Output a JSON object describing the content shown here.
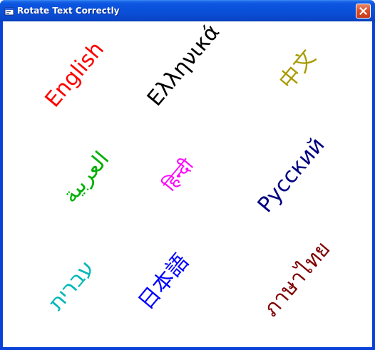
{
  "window": {
    "title": "Rotate Text Correctly"
  },
  "labels": [
    {
      "id": "english",
      "text": "English",
      "color": "#ff0000"
    },
    {
      "id": "greek",
      "text": "Ελληνικά",
      "color": "#000000"
    },
    {
      "id": "chinese",
      "text": "中文",
      "color": "#a89a00"
    },
    {
      "id": "arabic",
      "text": "العربية",
      "color": "#00b000"
    },
    {
      "id": "hindi",
      "text": "हिन्दी",
      "color": "#ff00ff"
    },
    {
      "id": "russian",
      "text": "Русский",
      "color": "#000080"
    },
    {
      "id": "hebrew",
      "text": "עברית",
      "color": "#00b8b8"
    },
    {
      "id": "japanese",
      "text": "日本語",
      "color": "#0000ff"
    },
    {
      "id": "thai",
      "text": "ภาษาไทย",
      "color": "#800000"
    }
  ]
}
